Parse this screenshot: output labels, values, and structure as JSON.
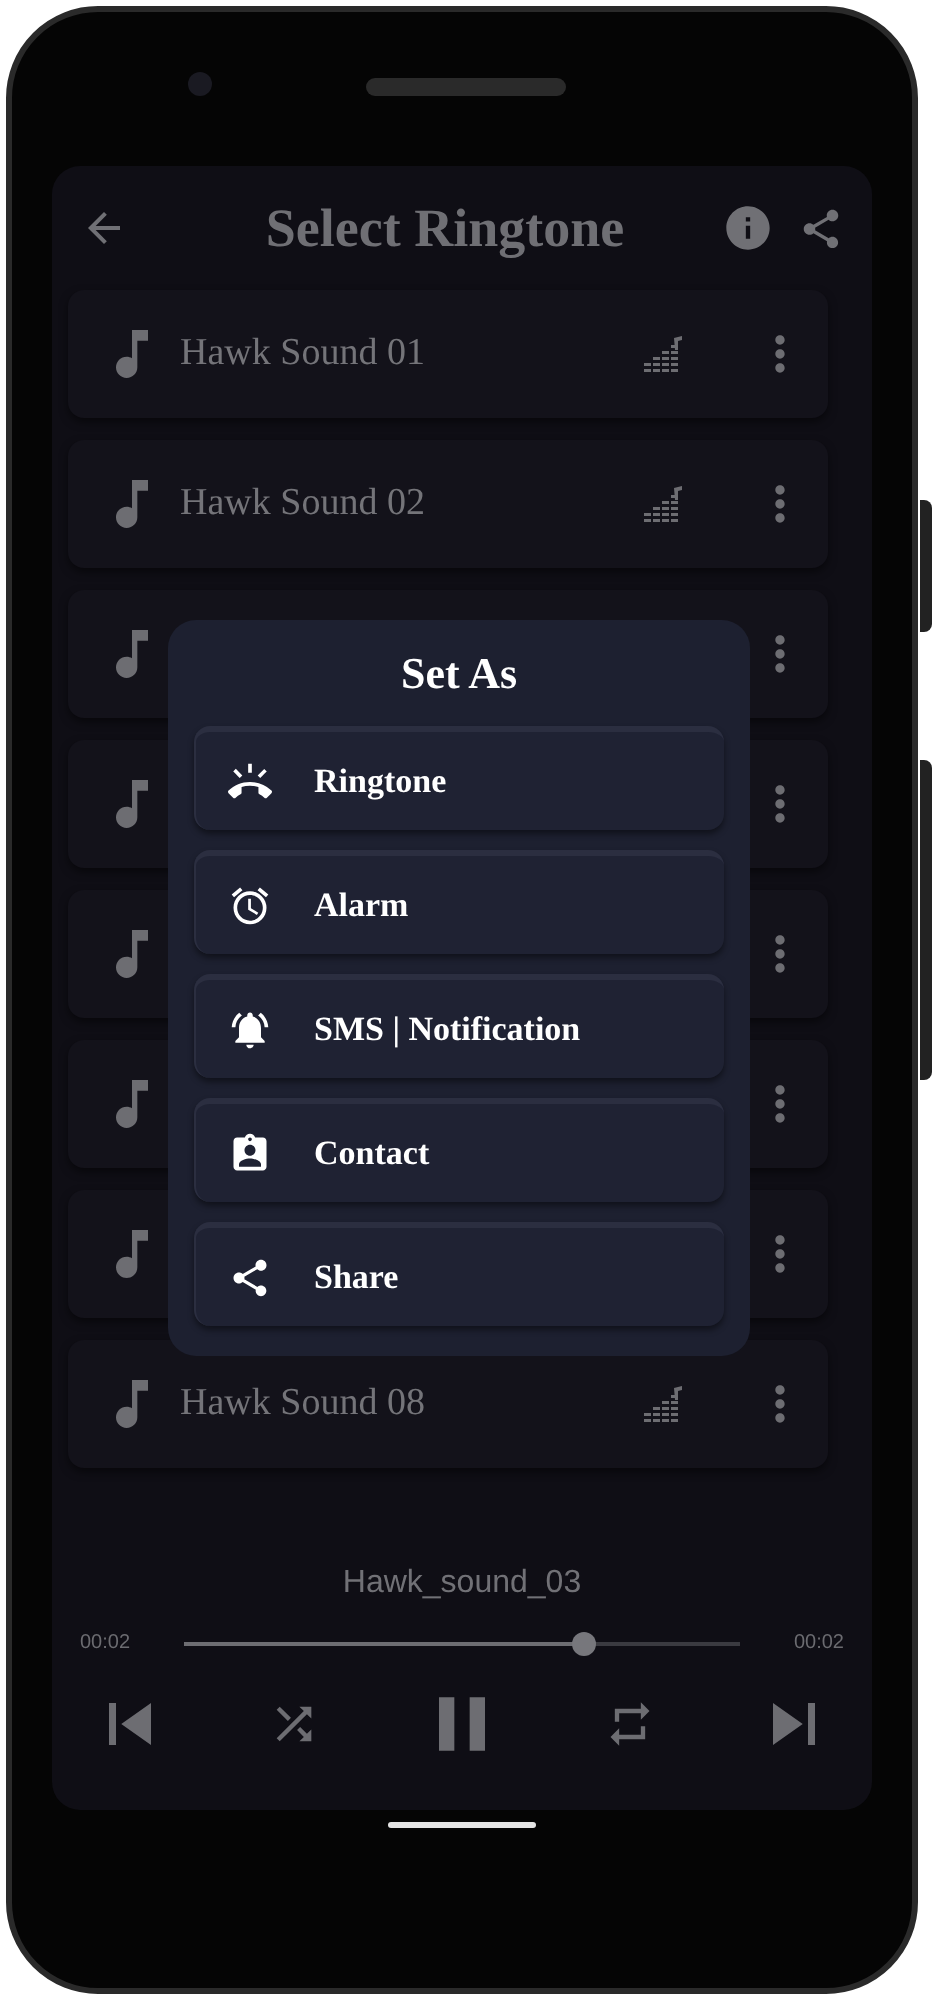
{
  "header": {
    "title": "Select Ringtone"
  },
  "sounds": [
    {
      "kind": "full",
      "name": "Hawk Sound 01"
    },
    {
      "kind": "full",
      "name": "Hawk Sound 02"
    },
    {
      "kind": "covered"
    },
    {
      "kind": "covered"
    },
    {
      "kind": "covered"
    },
    {
      "kind": "covered"
    },
    {
      "kind": "covered"
    },
    {
      "kind": "full",
      "name": "Hawk Sound 08"
    }
  ],
  "dialog": {
    "title": "Set As",
    "options": [
      {
        "kind": "ringtone",
        "label": "Ringtone"
      },
      {
        "kind": "alarm",
        "label": "Alarm"
      },
      {
        "kind": "notification",
        "label": "SMS | Notification"
      },
      {
        "kind": "contact",
        "label": "Contact"
      },
      {
        "kind": "share",
        "label": "Share"
      }
    ]
  },
  "player": {
    "track": "Hawk_sound_03",
    "elapsed": "00:02",
    "total": "00:02",
    "level": 0.72,
    "playing": true
  }
}
